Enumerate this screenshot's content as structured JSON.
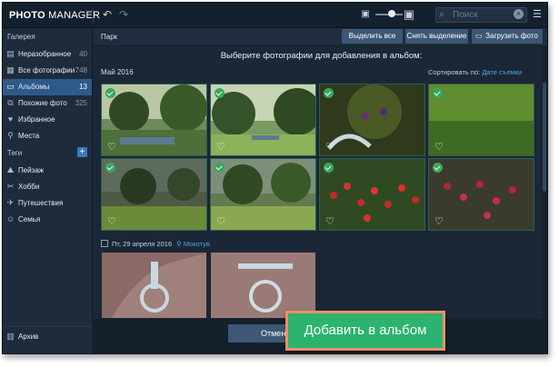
{
  "app": {
    "title_bold": "PHOTO",
    "title_rest": " MANAGER"
  },
  "topbar": {
    "undo_icon": "undo-icon",
    "redo_icon": "redo-icon",
    "zoom_small_icon": "image-small-icon",
    "zoom_large_icon": "image-large-icon",
    "zoom_level": 0.5,
    "search": {
      "placeholder": "Поиск",
      "value": ""
    }
  },
  "sidebar": {
    "gallery_header": "Галерея",
    "items": [
      {
        "label": "Неразобранное",
        "count": "40",
        "icon": "unsorted-icon"
      },
      {
        "label": "Все фотографии",
        "count": "748",
        "icon": "photos-icon"
      },
      {
        "label": "Альбомы",
        "count": "13",
        "icon": "album-icon",
        "active": true
      },
      {
        "label": "Похожие фото",
        "count": "325",
        "icon": "similar-icon"
      },
      {
        "label": "Избранное",
        "count": "",
        "icon": "heart-icon"
      },
      {
        "label": "Места",
        "count": "",
        "icon": "location-icon"
      }
    ],
    "tags_header": "Теги",
    "tags": [
      {
        "label": "Пейзаж",
        "icon": "tag-icon"
      },
      {
        "label": "Хобби",
        "icon": "tag-icon"
      },
      {
        "label": "Путешествия",
        "icon": "tag-icon"
      },
      {
        "label": "Семья",
        "icon": "tag-icon"
      }
    ],
    "archive": "Архив"
  },
  "main": {
    "breadcrumb": "Парк",
    "buttons": {
      "select_all": "Выделить все",
      "deselect": "Снять выделение",
      "upload": "Загрузить фото"
    },
    "prompt": "Выберите фотографии для добавления в альбом:",
    "group_title": "Май 2016",
    "sort_label": "Сортировать по:",
    "sort_value": "Дате съемки",
    "date_label": "Пт, 29 апреля 2016",
    "location": "Мокотув",
    "cancel": "Отмена",
    "add_to_album": "Добавить в альбом"
  },
  "colors": {
    "accent": "#2e5a8a",
    "check": "#37a85e",
    "add_button": "#2bb36f",
    "highlight_border": "#ef8f65",
    "link": "#4aa3e8"
  }
}
